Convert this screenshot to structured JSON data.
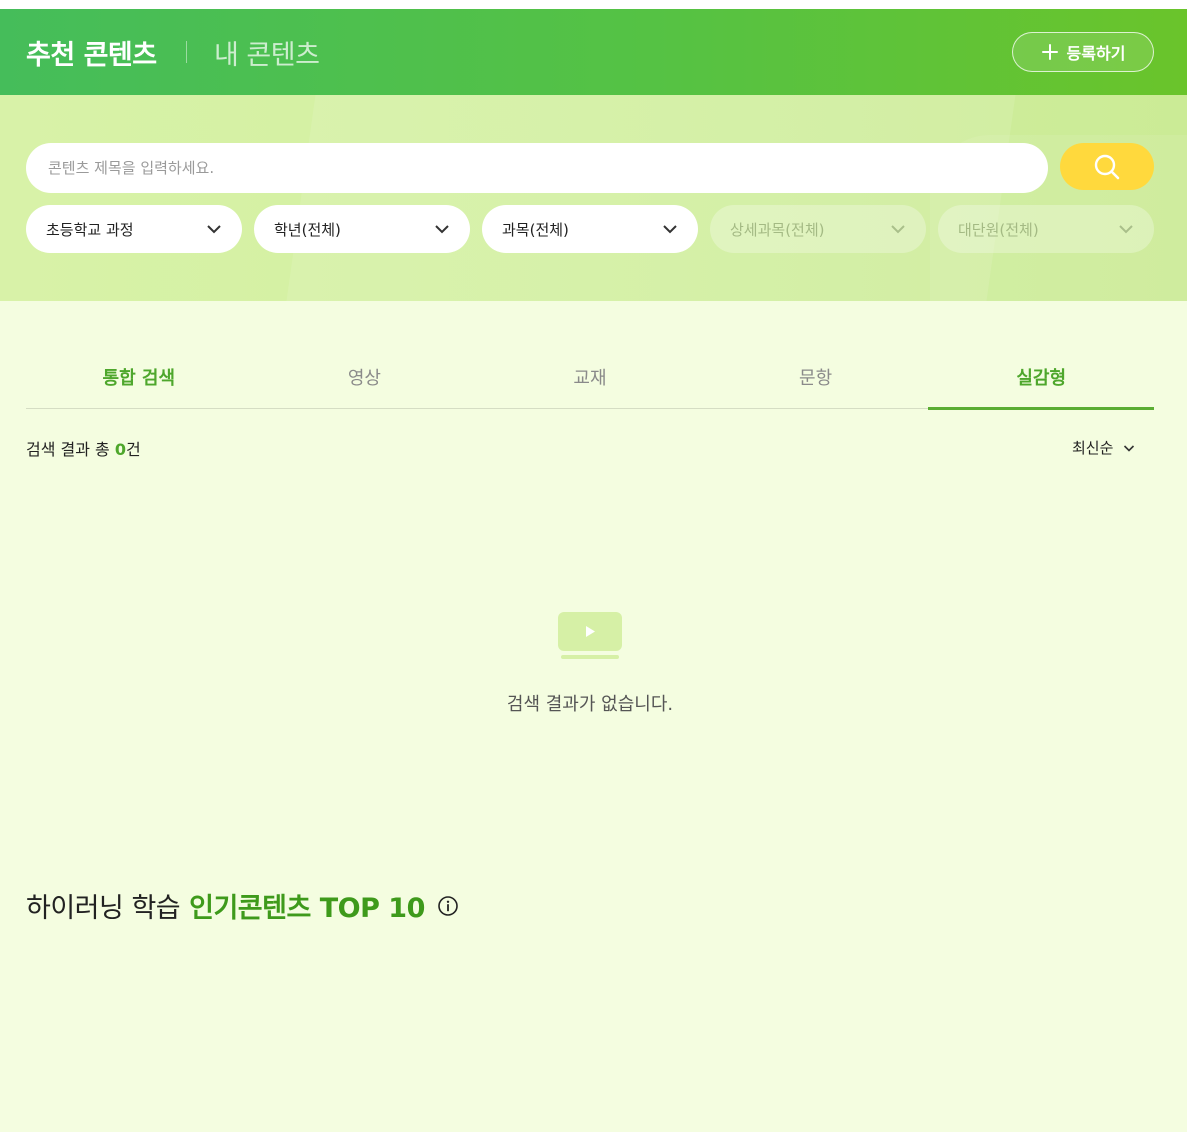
{
  "header": {
    "tab_recommended": "추천 콘텐츠",
    "tab_mine": "내 콘텐츠",
    "register_label": "등록하기"
  },
  "search": {
    "placeholder": "콘텐츠 제목을 입력하세요.",
    "filters": [
      {
        "label": "초등학교 과정",
        "enabled": true
      },
      {
        "label": "학년(전체)",
        "enabled": true
      },
      {
        "label": "과목(전체)",
        "enabled": true
      },
      {
        "label": "상세과목(전체)",
        "enabled": false
      },
      {
        "label": "대단원(전체)",
        "enabled": false
      }
    ]
  },
  "tabs": [
    {
      "label": "통합 검색"
    },
    {
      "label": "영상"
    },
    {
      "label": "교재"
    },
    {
      "label": "문항"
    },
    {
      "label": "실감형"
    }
  ],
  "results": {
    "prefix": "검색 결과 총 ",
    "count": "0",
    "suffix": "건",
    "sort_label": "최신순",
    "empty_message": "검색 결과가 없습니다."
  },
  "popular": {
    "title_prefix": "하이러닝 학습",
    "title_highlight": "인기콘텐츠 TOP 10"
  },
  "colors": {
    "accent": "#4ea72c",
    "header_start": "#45bd5a",
    "header_end": "#6ac42b",
    "search_button": "#ffd93d",
    "background": "#f4fde0"
  },
  "icons": [
    "plus-icon",
    "search-icon",
    "chevron-down-icon",
    "play-icon",
    "info-icon"
  ]
}
